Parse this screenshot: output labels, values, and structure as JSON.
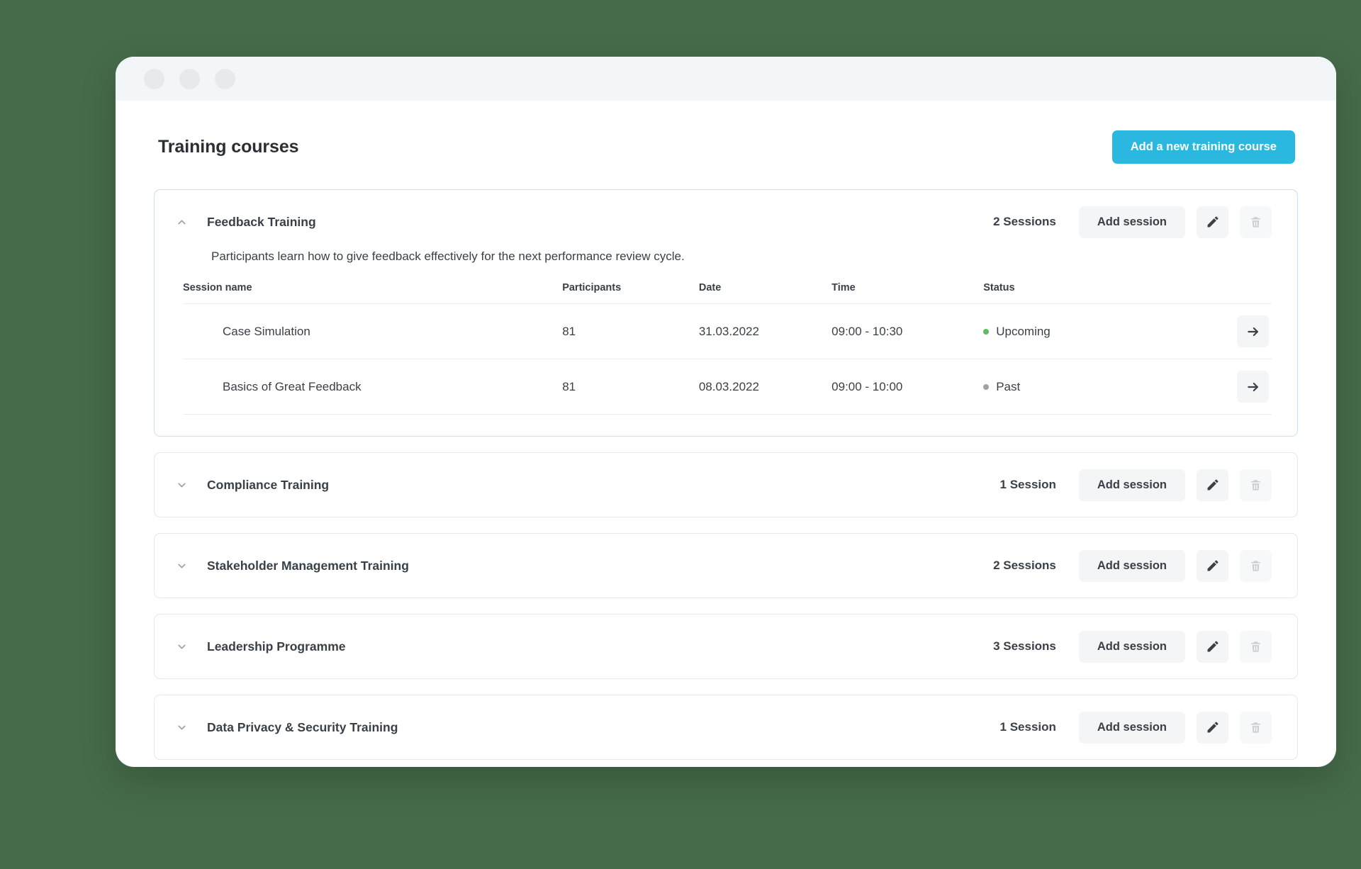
{
  "window": {
    "traffic_lights": [
      "close-dot",
      "minimize-dot",
      "maximize-dot"
    ]
  },
  "header": {
    "title": "Training courses",
    "add_course_label": "Add a new training course"
  },
  "colors": {
    "page_background": "#456b4a",
    "primary_button": "#2ab8e0",
    "expanded_card_border": "#c2e6f5",
    "card_border": "#e3e9ee",
    "status_upcoming": "#5fbb63",
    "status_past": "#9aa3ab",
    "soft_button": "#f3f5f7",
    "titlebar": "#f2f6f9"
  },
  "table": {
    "columns": [
      "Session name",
      "Participants",
      "Date",
      "Time",
      "Status",
      ""
    ]
  },
  "labels": {
    "add_session": "Add session",
    "edit_icon": "pencil-icon",
    "delete_icon": "trash-icon",
    "go_icon": "arrow-right-icon",
    "collapse_icon": "chevron-up-icon",
    "expand_icon": "chevron-down-icon"
  },
  "courses": [
    {
      "name": "Feedback Training",
      "session_count_label": "2 Sessions",
      "expanded": true,
      "description": "Participants learn how to give feedback effectively for the next performance review cycle.",
      "add_session_label": "Add session",
      "sessions": [
        {
          "name": "Case Simulation",
          "participants": "81",
          "date": "31.03.2022",
          "time": "09:00 - 10:30",
          "status": "Upcoming",
          "status_color": "#5fbb63"
        },
        {
          "name": "Basics of Great Feedback",
          "participants": "81",
          "date": "08.03.2022",
          "time": "09:00 - 10:00",
          "status": "Past",
          "status_color": "#9aa3ab"
        }
      ]
    },
    {
      "name": "Compliance Training",
      "session_count_label": "1 Session",
      "expanded": false,
      "add_session_label": "Add session"
    },
    {
      "name": "Stakeholder Management Training",
      "session_count_label": "2 Sessions",
      "expanded": false,
      "add_session_label": "Add session"
    },
    {
      "name": "Leadership Programme",
      "session_count_label": "3 Sessions",
      "expanded": false,
      "add_session_label": "Add session"
    },
    {
      "name": "Data Privacy & Security Training",
      "session_count_label": "1 Session",
      "expanded": false,
      "add_session_label": "Add session"
    }
  ]
}
